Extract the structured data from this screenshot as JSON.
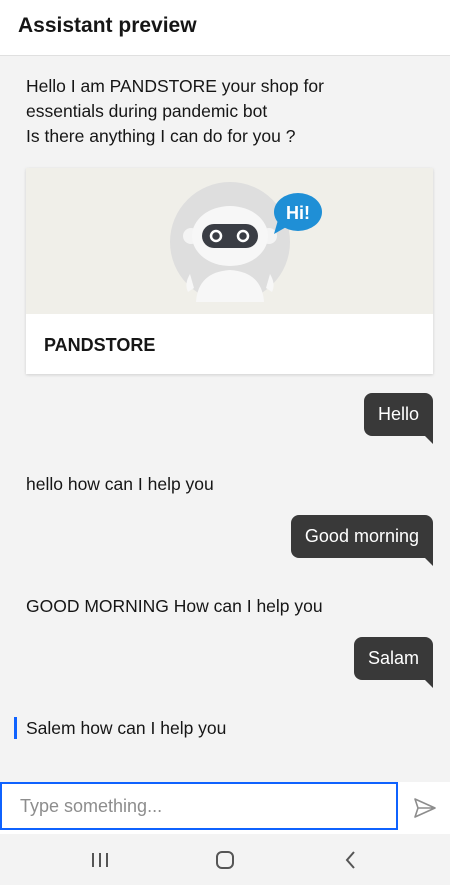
{
  "header": {
    "title": "Assistant preview"
  },
  "messages": {
    "welcome_line1": "Hello I am PANDSTORE your shop for",
    "welcome_line2": "essentials during pandemic bot",
    "welcome_line3": "Is there anything I can do for you ?",
    "card_title": "PANDSTORE",
    "card_badge": "Hi!",
    "user1": "Hello",
    "bot1": "hello how can I help you",
    "user2": "Good morning",
    "bot2": "GOOD MORNING How can I help you",
    "user3": "Salam",
    "bot3": "Salem how can I help you"
  },
  "input": {
    "placeholder": "Type something..."
  },
  "icons": {
    "send": "send-icon",
    "recents": "recent-apps-icon",
    "home": "home-icon",
    "back": "back-icon"
  },
  "colors": {
    "accent": "#0f62fe",
    "bubble": "#393939",
    "background": "#f3f3f3"
  }
}
